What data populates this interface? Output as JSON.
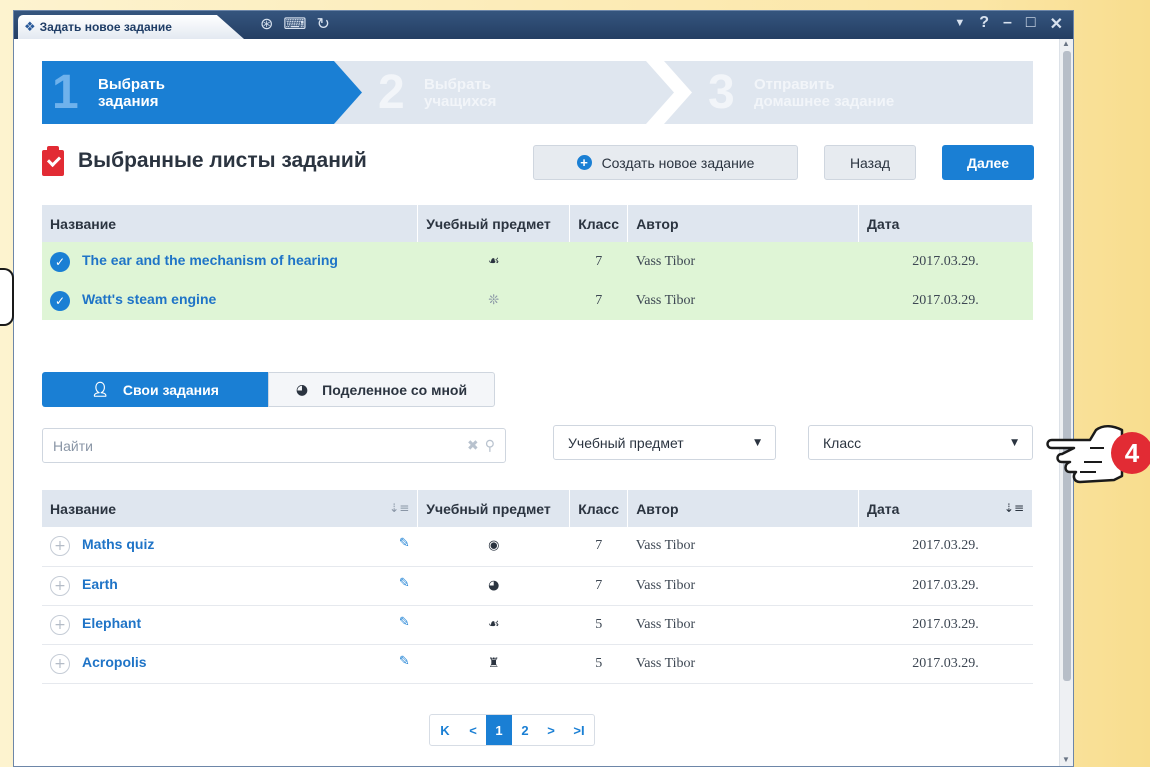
{
  "window": {
    "title": "Задать новое задание",
    "controls": [
      "▼",
      "?",
      "–",
      "□",
      "✕"
    ]
  },
  "steps": [
    {
      "num": "1",
      "label_line1": "Выбрать",
      "label_line2": "задания"
    },
    {
      "num": "2",
      "label_line1": "Выбрать",
      "label_line2": "учащихся"
    },
    {
      "num": "3",
      "label_line1": "Отправить",
      "label_line2": "домашнее задание"
    }
  ],
  "section": {
    "title": "Выбранные листы заданий"
  },
  "buttons": {
    "create": "Создать новое задание",
    "back": "Назад",
    "next": "Далее"
  },
  "columns": {
    "name": "Название",
    "subject": "Учебный предмет",
    "class": "Класс",
    "author": "Автор",
    "date": "Дата"
  },
  "selected": [
    {
      "title": "The ear and the mechanism of hearing",
      "subject_icon": "ear-icon",
      "subject_glyph": "☙",
      "class": "7",
      "author": "Vass Tibor",
      "date": "2017.03.29."
    },
    {
      "title": "Watt's steam engine",
      "subject_icon": "gear-icon",
      "subject_glyph": "❊",
      "class": "7",
      "author": "Vass Tibor",
      "date": "2017.03.29."
    }
  ],
  "tabs": {
    "own": "Свои задания",
    "shared": "Поделенное со мной"
  },
  "filters": {
    "search_placeholder": "Найти",
    "subject": "Учебный предмет",
    "class": "Класс"
  },
  "tasks": [
    {
      "title": "Maths quiz",
      "subject_icon": "globe-icon",
      "subject_glyph": "◉",
      "class": "7",
      "author": "Vass Tibor",
      "date": "2017.03.29."
    },
    {
      "title": "Earth",
      "subject_icon": "earth-icon",
      "subject_glyph": "◕",
      "class": "7",
      "author": "Vass Tibor",
      "date": "2017.03.29."
    },
    {
      "title": "Elephant",
      "subject_icon": "animal-icon",
      "subject_glyph": "☙",
      "class": "5",
      "author": "Vass Tibor",
      "date": "2017.03.29."
    },
    {
      "title": "Acropolis",
      "subject_icon": "history-icon",
      "subject_glyph": "♜",
      "class": "5",
      "author": "Vass Tibor",
      "date": "2017.03.29."
    }
  ],
  "pagination": {
    "first": "K",
    "prev": "<",
    "pages": [
      "1",
      "2"
    ],
    "active": "1",
    "next": ">",
    "last": ">I"
  },
  "callout": {
    "number": "4"
  },
  "colors": {
    "accent": "#1a7fd4",
    "selected_row": "#dff5d6",
    "brand_red": "#e22b34"
  }
}
